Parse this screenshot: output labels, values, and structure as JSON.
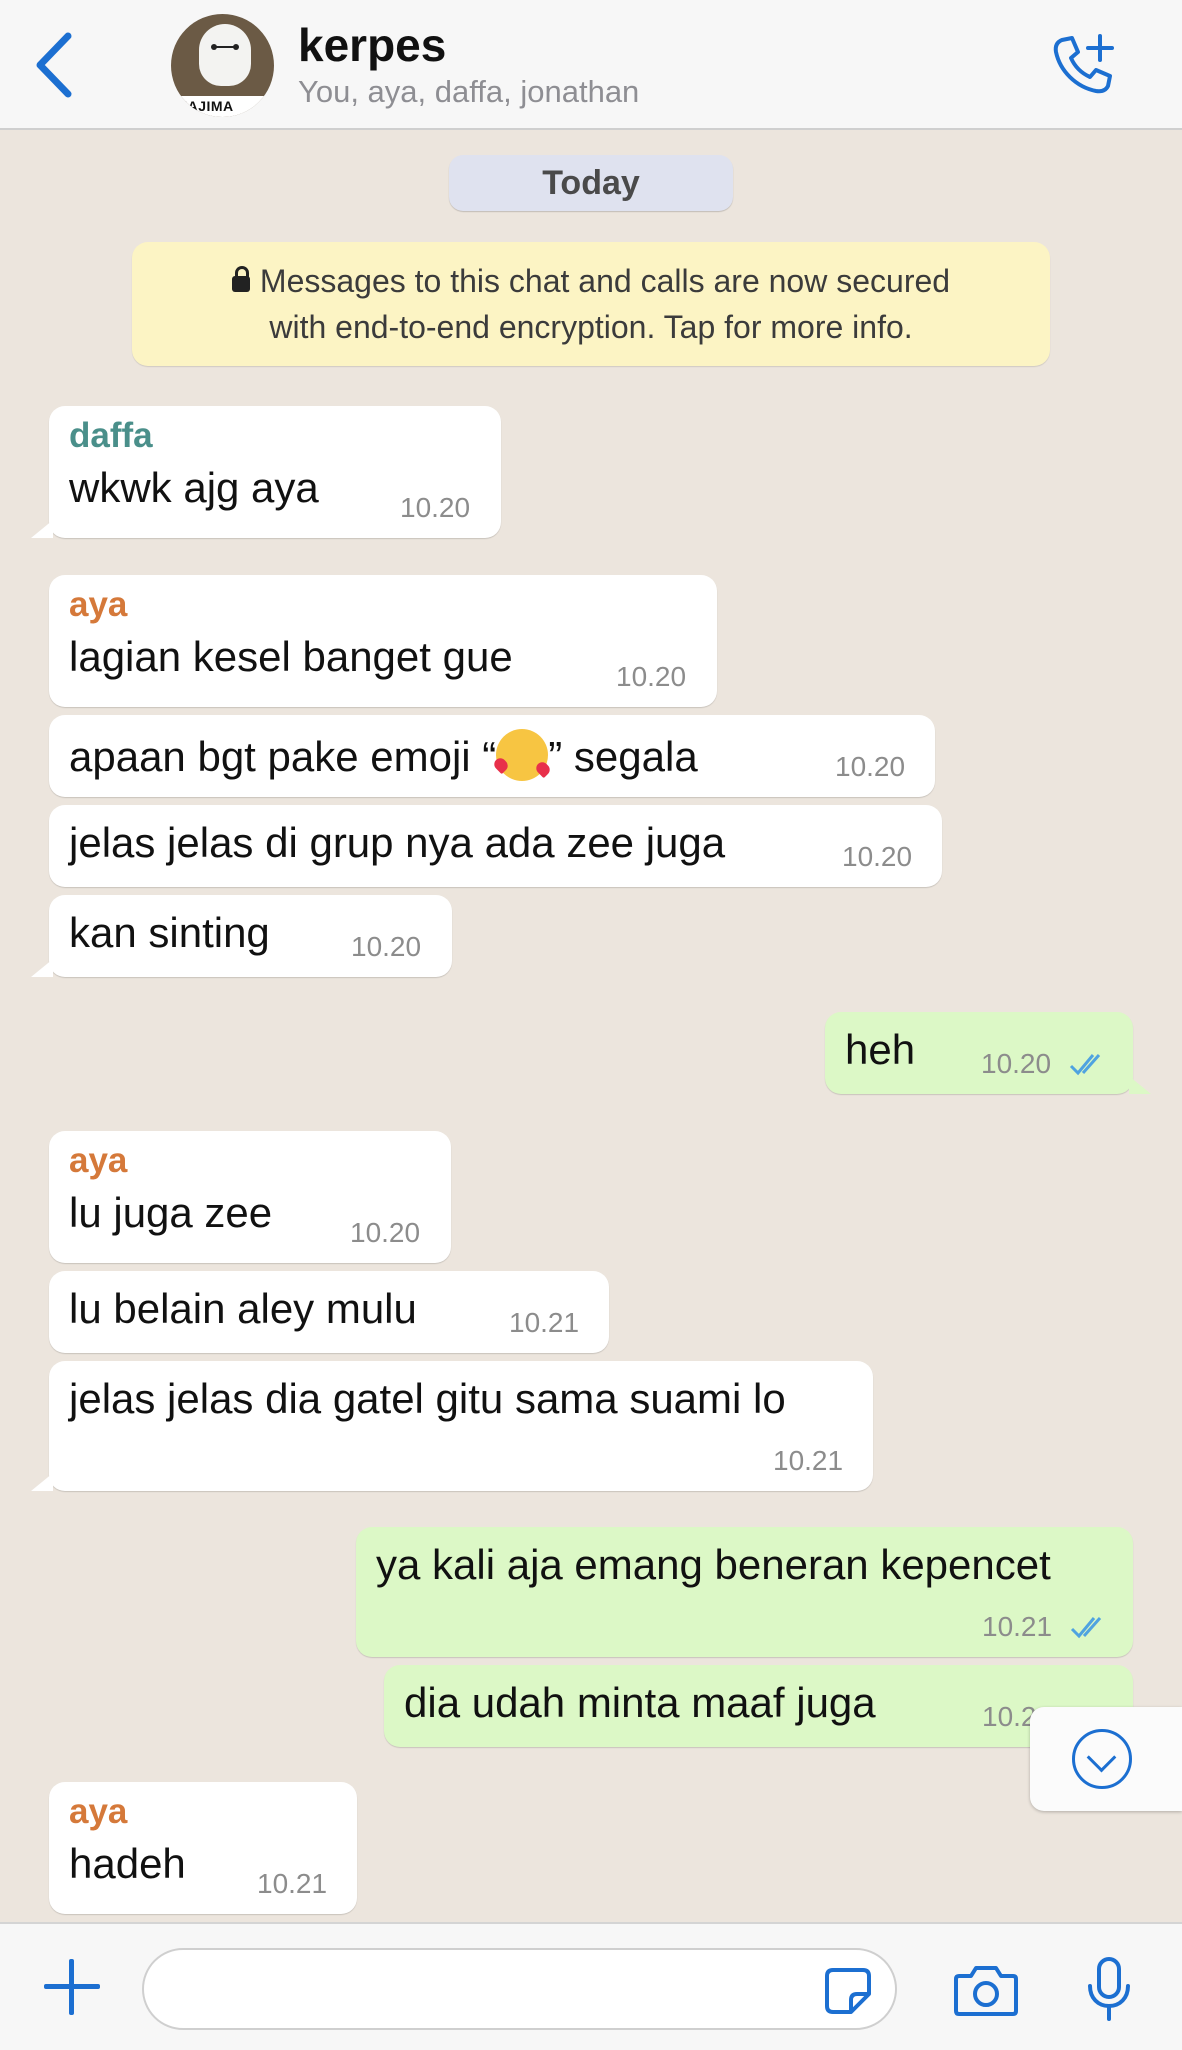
{
  "header": {
    "title": "kerpes",
    "participants": "You, aya, daffa, jonathan",
    "avatar_text": "HAJIMA"
  },
  "chat": {
    "day_label": "Today",
    "encryption_notice_line1": "Messages to this chat and calls are now secured",
    "encryption_notice_line2": "with end-to-end encryption. Tap for more info.",
    "messages": [
      {
        "sender": "daffa",
        "text": "wkwk ajg aya",
        "time": "10.20",
        "dir": "in"
      },
      {
        "sender": "aya",
        "text": "lagian kesel banget gue",
        "time": "10.20",
        "dir": "in"
      },
      {
        "text_before_emoji": "apaan bgt pake emoji “",
        "text_after_emoji": "” segala",
        "time": "10.20",
        "dir": "in",
        "emoji": "smiling-face-with-hearts"
      },
      {
        "text": "jelas jelas di grup nya ada zee juga",
        "time": "10.20",
        "dir": "in"
      },
      {
        "text": "kan sinting",
        "time": "10.20",
        "dir": "in"
      },
      {
        "text": "heh",
        "time": "10.20",
        "dir": "out",
        "status": "read"
      },
      {
        "sender": "aya",
        "text": "lu juga zee",
        "time": "10.20",
        "dir": "in"
      },
      {
        "text": "lu belain aley mulu",
        "time": "10.21",
        "dir": "in"
      },
      {
        "text": "jelas jelas dia gatel gitu sama suami lo",
        "time": "10.21",
        "dir": "in"
      },
      {
        "text": "ya kali aja emang beneran kepencet",
        "time": "10.21",
        "dir": "out",
        "status": "read"
      },
      {
        "text": "dia udah minta maaf juga",
        "time": "10.2",
        "dir": "out"
      },
      {
        "sender": "aya",
        "text": "hadeh",
        "time": "10.21",
        "dir": "in"
      }
    ]
  },
  "colors": {
    "accent": "#1c6fd1",
    "outgoing_bubble": "#dcf8c6",
    "incoming_bubble": "#ffffff",
    "sender_daffa": "#4a8f8a",
    "sender_aya": "#d5793a",
    "read_ticks": "#4fa3e0"
  },
  "icons": [
    "back-chevron-icon",
    "add-call-icon",
    "scroll-down-icon",
    "plus-icon",
    "sticker-icon",
    "camera-icon",
    "microphone-icon"
  ]
}
